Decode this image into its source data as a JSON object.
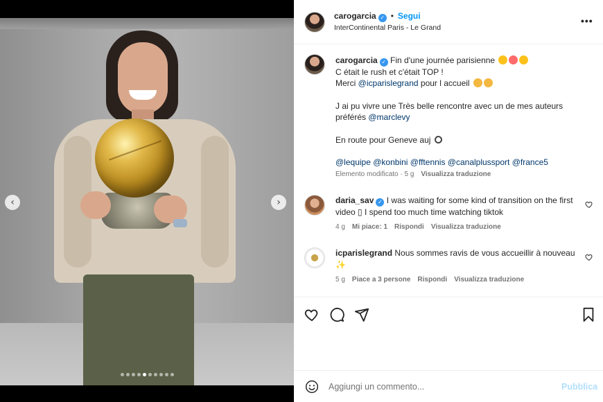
{
  "header": {
    "username": "carogarcia",
    "follow_label": "Segui",
    "separator": "•",
    "location": "InterContinental Paris - Le Grand",
    "more_label": "•••"
  },
  "caption": {
    "username": "carogarcia",
    "line1": "Fin d'une journée parisienne",
    "line2": "C était le rush et c'était TOP !",
    "line3_pre": "Merci ",
    "line3_mention": "@icparislegrand",
    "line3_post": " pour l accueil",
    "line4_pre": "J ai pu vivre une Très belle rencontre avec un de mes auteurs préférés ",
    "line4_mention": "@marclevy",
    "line5": "En route pour Geneve auj",
    "tags": [
      "@lequipe",
      "@konbini",
      "@fftennis",
      "@canalplussport",
      "@france5"
    ],
    "meta_edited": "Elemento modificato · 5 g",
    "meta_translate": "Visualizza traduzione"
  },
  "comments": [
    {
      "username": "daria_sav",
      "verified": true,
      "text": "I was waiting for some kind of transition on the first video ▯ I spend too much time watching tiktok",
      "time": "4 g",
      "likes": "Mi piace: 1",
      "reply": "Rispondi",
      "translate": "Visualizza traduzione"
    },
    {
      "username": "icparislegrand",
      "verified": false,
      "text": "Nous sommes ravis de vous accueillir à nouveau ✨",
      "time": "5 g",
      "likes": "Piace a 3 persone",
      "reply": "Rispondi",
      "translate": "Visualizza traduzione"
    }
  ],
  "composer": {
    "placeholder": "Aggiungi un commento...",
    "publish_label": "Pubblica"
  },
  "carousel": {
    "dot_count": 10,
    "active_index": 4,
    "prev_label": "‹",
    "next_label": "›"
  },
  "icons": {
    "like": "heart-icon",
    "comment": "comment-icon",
    "share": "send-icon",
    "save": "bookmark-icon",
    "emoji": "smiley-icon"
  },
  "colors": {
    "accent": "#0095f6",
    "mention": "#00376b",
    "verified": "#3797f0",
    "publish_disabled": "#b2dffc"
  }
}
